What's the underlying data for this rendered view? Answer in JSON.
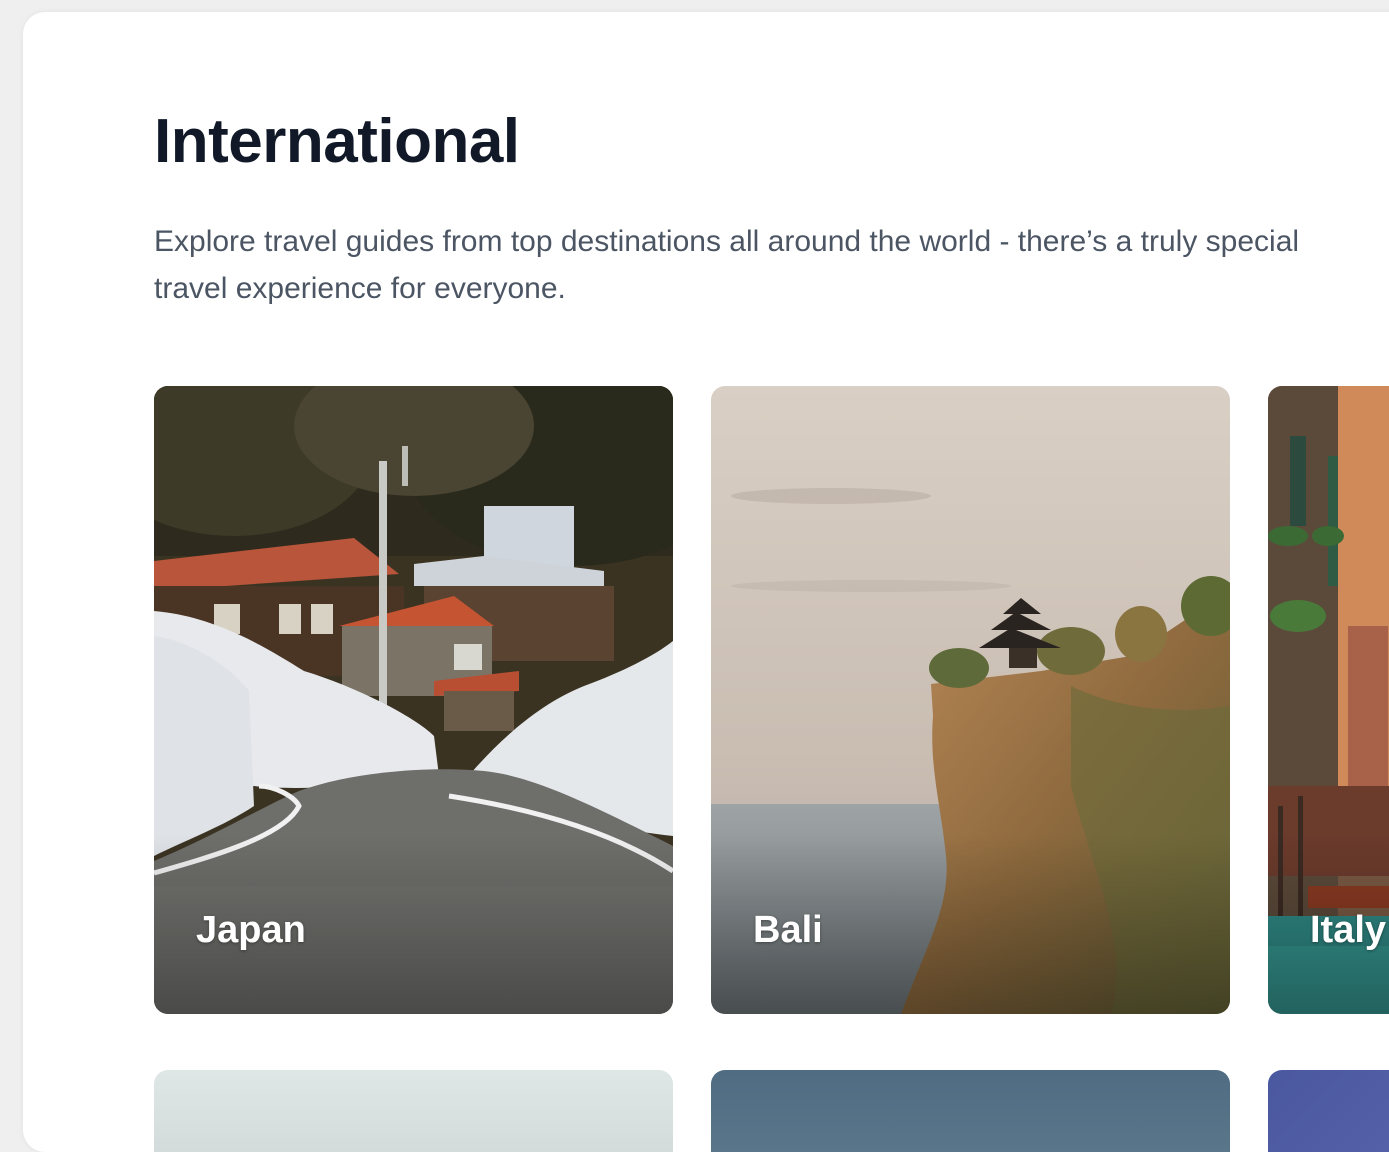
{
  "section": {
    "title": "International",
    "description": "Explore travel guides from top destinations all around the world - there’s a truly special travel experience for everyone."
  },
  "destinations": [
    {
      "label": "Japan"
    },
    {
      "label": "Bali"
    },
    {
      "label": "Italy"
    }
  ]
}
